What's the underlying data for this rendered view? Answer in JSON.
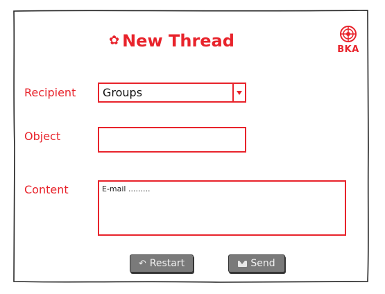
{
  "header": {
    "title": "New Thread",
    "title_icon": "bird-icon",
    "logo_icon": "globe-icon",
    "logo_text": "BKA"
  },
  "form": {
    "recipient_label": "Recipient",
    "recipient_value": "Groups",
    "object_label": "Object",
    "object_value": "",
    "content_label": "Content",
    "content_value": "E-mail ........."
  },
  "actions": {
    "restart_label": "Restart",
    "restart_icon": "undo-icon",
    "send_label": "Send",
    "send_icon": "envelope-icon"
  },
  "colors": {
    "accent": "#e8232b",
    "button": "#7a7a7a"
  }
}
